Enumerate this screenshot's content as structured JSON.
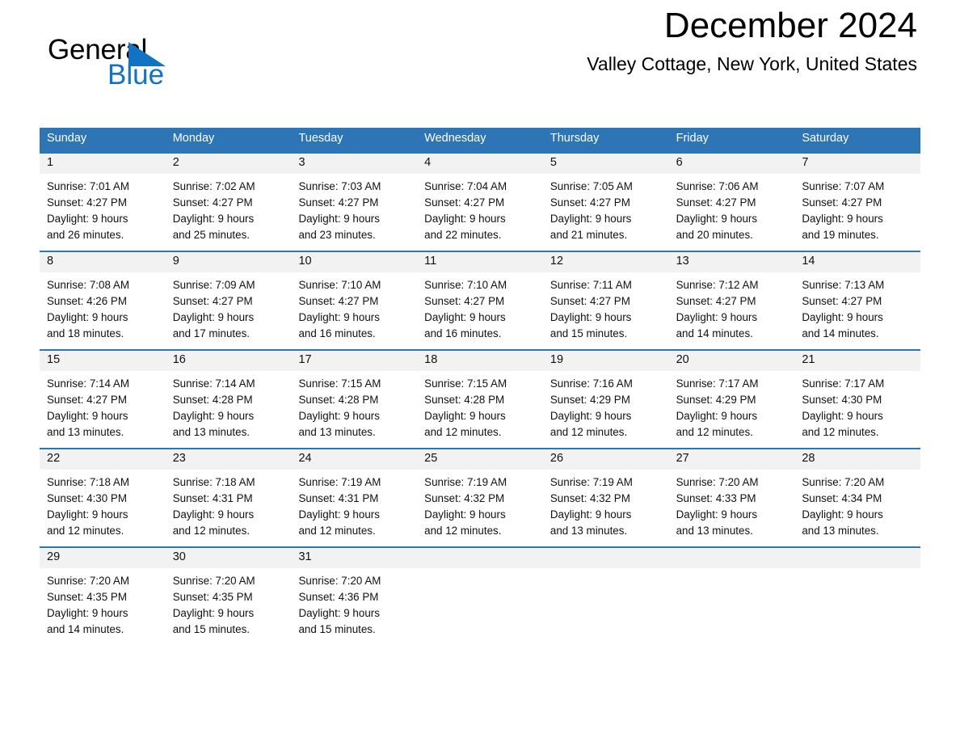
{
  "logo": {
    "word_one": "General",
    "word_two": "Blue",
    "triangle_color": "#1273c6"
  },
  "header": {
    "title": "December 2024",
    "location": "Valley Cottage, New York, United States"
  },
  "theme": {
    "header_blue": "#2e75b6",
    "day_band_gray": "#f2f2f2",
    "text_color": "#111111",
    "header_text_color": "#ffffff"
  },
  "weekdays": [
    "Sunday",
    "Monday",
    "Tuesday",
    "Wednesday",
    "Thursday",
    "Friday",
    "Saturday"
  ],
  "weeks": [
    [
      {
        "day": "1",
        "sunrise": "Sunrise: 7:01 AM",
        "sunset": "Sunset: 4:27 PM",
        "daylight_1": "Daylight: 9 hours",
        "daylight_2": "and 26 minutes."
      },
      {
        "day": "2",
        "sunrise": "Sunrise: 7:02 AM",
        "sunset": "Sunset: 4:27 PM",
        "daylight_1": "Daylight: 9 hours",
        "daylight_2": "and 25 minutes."
      },
      {
        "day": "3",
        "sunrise": "Sunrise: 7:03 AM",
        "sunset": "Sunset: 4:27 PM",
        "daylight_1": "Daylight: 9 hours",
        "daylight_2": "and 23 minutes."
      },
      {
        "day": "4",
        "sunrise": "Sunrise: 7:04 AM",
        "sunset": "Sunset: 4:27 PM",
        "daylight_1": "Daylight: 9 hours",
        "daylight_2": "and 22 minutes."
      },
      {
        "day": "5",
        "sunrise": "Sunrise: 7:05 AM",
        "sunset": "Sunset: 4:27 PM",
        "daylight_1": "Daylight: 9 hours",
        "daylight_2": "and 21 minutes."
      },
      {
        "day": "6",
        "sunrise": "Sunrise: 7:06 AM",
        "sunset": "Sunset: 4:27 PM",
        "daylight_1": "Daylight: 9 hours",
        "daylight_2": "and 20 minutes."
      },
      {
        "day": "7",
        "sunrise": "Sunrise: 7:07 AM",
        "sunset": "Sunset: 4:27 PM",
        "daylight_1": "Daylight: 9 hours",
        "daylight_2": "and 19 minutes."
      }
    ],
    [
      {
        "day": "8",
        "sunrise": "Sunrise: 7:08 AM",
        "sunset": "Sunset: 4:26 PM",
        "daylight_1": "Daylight: 9 hours",
        "daylight_2": "and 18 minutes."
      },
      {
        "day": "9",
        "sunrise": "Sunrise: 7:09 AM",
        "sunset": "Sunset: 4:27 PM",
        "daylight_1": "Daylight: 9 hours",
        "daylight_2": "and 17 minutes."
      },
      {
        "day": "10",
        "sunrise": "Sunrise: 7:10 AM",
        "sunset": "Sunset: 4:27 PM",
        "daylight_1": "Daylight: 9 hours",
        "daylight_2": "and 16 minutes."
      },
      {
        "day": "11",
        "sunrise": "Sunrise: 7:10 AM",
        "sunset": "Sunset: 4:27 PM",
        "daylight_1": "Daylight: 9 hours",
        "daylight_2": "and 16 minutes."
      },
      {
        "day": "12",
        "sunrise": "Sunrise: 7:11 AM",
        "sunset": "Sunset: 4:27 PM",
        "daylight_1": "Daylight: 9 hours",
        "daylight_2": "and 15 minutes."
      },
      {
        "day": "13",
        "sunrise": "Sunrise: 7:12 AM",
        "sunset": "Sunset: 4:27 PM",
        "daylight_1": "Daylight: 9 hours",
        "daylight_2": "and 14 minutes."
      },
      {
        "day": "14",
        "sunrise": "Sunrise: 7:13 AM",
        "sunset": "Sunset: 4:27 PM",
        "daylight_1": "Daylight: 9 hours",
        "daylight_2": "and 14 minutes."
      }
    ],
    [
      {
        "day": "15",
        "sunrise": "Sunrise: 7:14 AM",
        "sunset": "Sunset: 4:27 PM",
        "daylight_1": "Daylight: 9 hours",
        "daylight_2": "and 13 minutes."
      },
      {
        "day": "16",
        "sunrise": "Sunrise: 7:14 AM",
        "sunset": "Sunset: 4:28 PM",
        "daylight_1": "Daylight: 9 hours",
        "daylight_2": "and 13 minutes."
      },
      {
        "day": "17",
        "sunrise": "Sunrise: 7:15 AM",
        "sunset": "Sunset: 4:28 PM",
        "daylight_1": "Daylight: 9 hours",
        "daylight_2": "and 13 minutes."
      },
      {
        "day": "18",
        "sunrise": "Sunrise: 7:15 AM",
        "sunset": "Sunset: 4:28 PM",
        "daylight_1": "Daylight: 9 hours",
        "daylight_2": "and 12 minutes."
      },
      {
        "day": "19",
        "sunrise": "Sunrise: 7:16 AM",
        "sunset": "Sunset: 4:29 PM",
        "daylight_1": "Daylight: 9 hours",
        "daylight_2": "and 12 minutes."
      },
      {
        "day": "20",
        "sunrise": "Sunrise: 7:17 AM",
        "sunset": "Sunset: 4:29 PM",
        "daylight_1": "Daylight: 9 hours",
        "daylight_2": "and 12 minutes."
      },
      {
        "day": "21",
        "sunrise": "Sunrise: 7:17 AM",
        "sunset": "Sunset: 4:30 PM",
        "daylight_1": "Daylight: 9 hours",
        "daylight_2": "and 12 minutes."
      }
    ],
    [
      {
        "day": "22",
        "sunrise": "Sunrise: 7:18 AM",
        "sunset": "Sunset: 4:30 PM",
        "daylight_1": "Daylight: 9 hours",
        "daylight_2": "and 12 minutes."
      },
      {
        "day": "23",
        "sunrise": "Sunrise: 7:18 AM",
        "sunset": "Sunset: 4:31 PM",
        "daylight_1": "Daylight: 9 hours",
        "daylight_2": "and 12 minutes."
      },
      {
        "day": "24",
        "sunrise": "Sunrise: 7:19 AM",
        "sunset": "Sunset: 4:31 PM",
        "daylight_1": "Daylight: 9 hours",
        "daylight_2": "and 12 minutes."
      },
      {
        "day": "25",
        "sunrise": "Sunrise: 7:19 AM",
        "sunset": "Sunset: 4:32 PM",
        "daylight_1": "Daylight: 9 hours",
        "daylight_2": "and 12 minutes."
      },
      {
        "day": "26",
        "sunrise": "Sunrise: 7:19 AM",
        "sunset": "Sunset: 4:32 PM",
        "daylight_1": "Daylight: 9 hours",
        "daylight_2": "and 13 minutes."
      },
      {
        "day": "27",
        "sunrise": "Sunrise: 7:20 AM",
        "sunset": "Sunset: 4:33 PM",
        "daylight_1": "Daylight: 9 hours",
        "daylight_2": "and 13 minutes."
      },
      {
        "day": "28",
        "sunrise": "Sunrise: 7:20 AM",
        "sunset": "Sunset: 4:34 PM",
        "daylight_1": "Daylight: 9 hours",
        "daylight_2": "and 13 minutes."
      }
    ],
    [
      {
        "day": "29",
        "sunrise": "Sunrise: 7:20 AM",
        "sunset": "Sunset: 4:35 PM",
        "daylight_1": "Daylight: 9 hours",
        "daylight_2": "and 14 minutes."
      },
      {
        "day": "30",
        "sunrise": "Sunrise: 7:20 AM",
        "sunset": "Sunset: 4:35 PM",
        "daylight_1": "Daylight: 9 hours",
        "daylight_2": "and 15 minutes."
      },
      {
        "day": "31",
        "sunrise": "Sunrise: 7:20 AM",
        "sunset": "Sunset: 4:36 PM",
        "daylight_1": "Daylight: 9 hours",
        "daylight_2": "and 15 minutes."
      },
      {
        "day": "",
        "sunrise": "",
        "sunset": "",
        "daylight_1": "",
        "daylight_2": ""
      },
      {
        "day": "",
        "sunrise": "",
        "sunset": "",
        "daylight_1": "",
        "daylight_2": ""
      },
      {
        "day": "",
        "sunrise": "",
        "sunset": "",
        "daylight_1": "",
        "daylight_2": ""
      },
      {
        "day": "",
        "sunrise": "",
        "sunset": "",
        "daylight_1": "",
        "daylight_2": ""
      }
    ]
  ]
}
